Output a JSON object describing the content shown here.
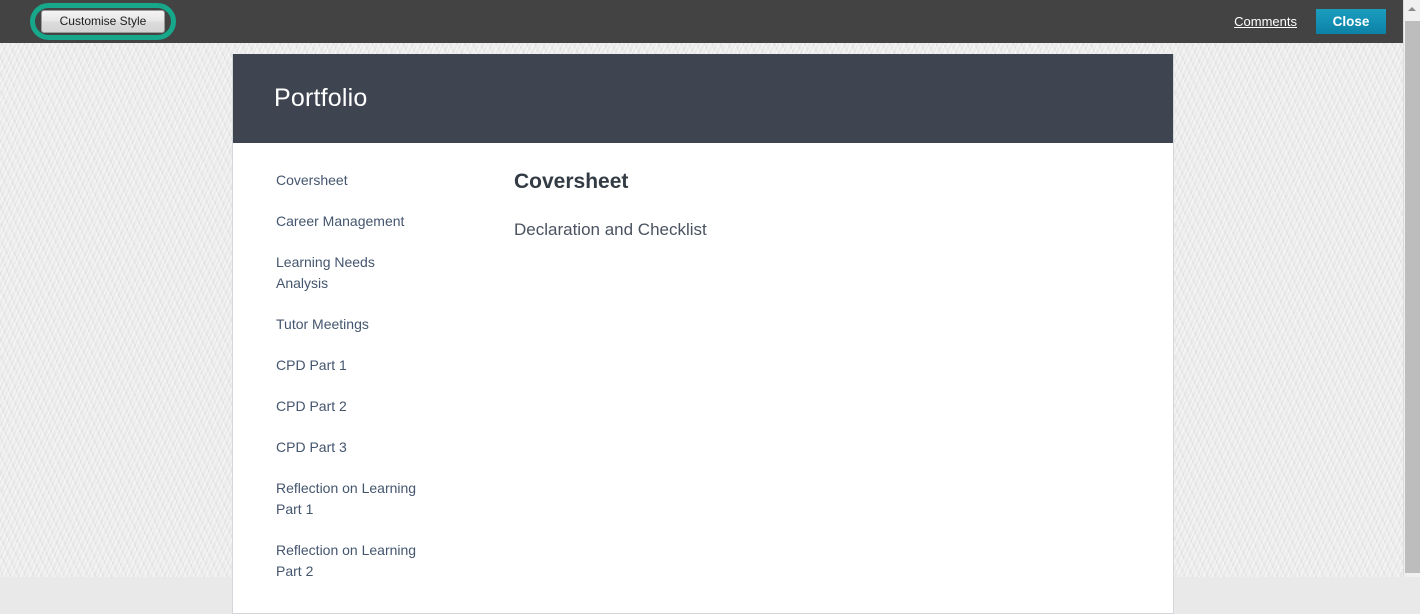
{
  "toolbar": {
    "customise_style_label": "Customise Style",
    "comments_label": "Comments",
    "close_label": "Close",
    "accent_ring_color": "#17a78b",
    "close_button_color": "#1390b4",
    "background_color": "#434343"
  },
  "scrollbar": {
    "up_arrow_icon": "triangle-up-icon"
  },
  "panel": {
    "header": {
      "title": "Portfolio",
      "background_color": "#3f4550"
    },
    "sidebar": {
      "items": [
        {
          "label": "Coversheet"
        },
        {
          "label": "Career Management"
        },
        {
          "label": "Learning Needs Analysis"
        },
        {
          "label": "Tutor Meetings"
        },
        {
          "label": "CPD Part 1"
        },
        {
          "label": "CPD Part 2"
        },
        {
          "label": "CPD Part 3"
        },
        {
          "label": "Reflection on Learning Part 1"
        },
        {
          "label": "Reflection on Learning Part 2"
        }
      ]
    },
    "content": {
      "title": "Coversheet",
      "subtitle": "Declaration and Checklist"
    }
  }
}
